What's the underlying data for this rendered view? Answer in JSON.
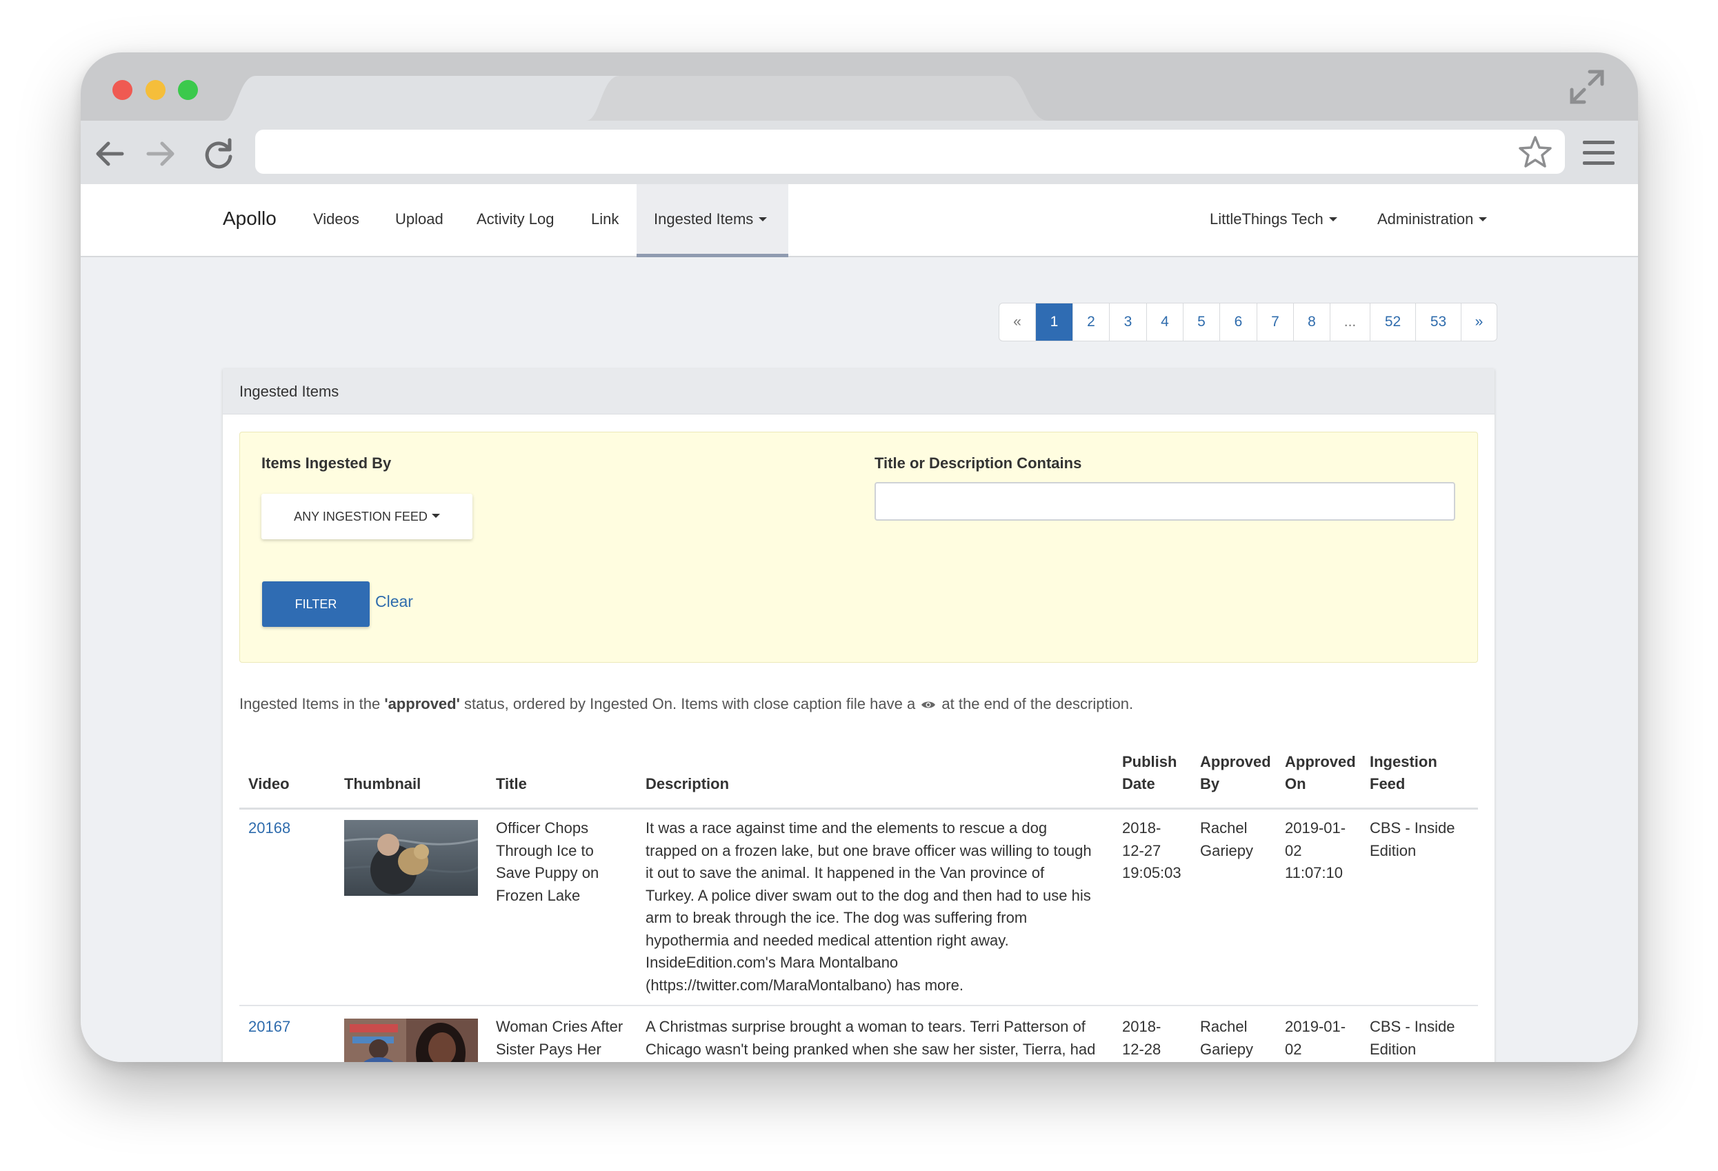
{
  "app": {
    "brand": "Apollo",
    "nav": [
      "Videos",
      "Upload",
      "Activity Log",
      "Link"
    ],
    "active_nav": "Ingested Items",
    "right_nav": [
      "LittleThings Tech",
      "Administration"
    ]
  },
  "pagination": {
    "prev": "«",
    "pages": [
      "1",
      "2",
      "3",
      "4",
      "5",
      "6",
      "7",
      "8",
      "...",
      "52",
      "53"
    ],
    "next": "»",
    "active": "1"
  },
  "panel": {
    "title": "Ingested Items",
    "filter": {
      "ingested_by_label": "Items Ingested By",
      "feed_button": "ANY INGESTION FEED",
      "title_label": "Title or Description Contains",
      "title_value": "",
      "filter_button": "FILTER",
      "clear_link": "Clear"
    },
    "info": {
      "prefix": "Ingested Items in the ",
      "status": "'approved'",
      "middle": " status, ordered by Ingested On. Items with close caption file have a",
      "suffix": " at the end of the description."
    }
  },
  "table": {
    "headers": {
      "video": "Video",
      "thumbnail": "Thumbnail",
      "title": "Title",
      "description": "Description",
      "publish_line1": "Publish",
      "publish_line2": "Date",
      "approved_by_line1": "Approved",
      "approved_by_line2": "By",
      "approved_on_line1": "Approved",
      "approved_on_line2": "On",
      "feed_line1": "Ingestion",
      "feed_line2": "Feed"
    },
    "rows": [
      {
        "video": "20168",
        "title": [
          "Officer Chops",
          "Through Ice to",
          "Save Puppy on",
          "Frozen Lake"
        ],
        "description": [
          "It was a race against time and the elements to rescue a dog",
          "trapped on a frozen lake, but one brave officer was willing to tough",
          "it out to save the animal. It happened in the Van province of",
          "Turkey. A police diver swam out to the dog and then had to use his",
          "arm to break through the ice. The dog was suffering from",
          "hypothermia and needed medical attention right away.",
          "InsideEdition.com's Mara Montalbano",
          "(https://twitter.com/MaraMontalbano) has more."
        ],
        "publish_date": [
          "2018-",
          "12-27",
          "19:05:03"
        ],
        "approved_by": [
          "Rachel",
          "Gariepy"
        ],
        "approved_on": [
          "2019-01-",
          "02",
          "11:07:10"
        ],
        "feed": [
          "CBS - Inside",
          "Edition"
        ]
      },
      {
        "video": "20167",
        "title": [
          "Woman Cries After",
          "Sister Pays Her"
        ],
        "description": [
          "A Christmas surprise brought a woman to tears. Terri Patterson of",
          "Chicago wasn't being pranked when she saw her sister, Tierra, had"
        ],
        "publish_date": [
          "2018-",
          "12-28"
        ],
        "approved_by": [
          "Rachel",
          "Gariepy"
        ],
        "approved_on": [
          "2019-01-",
          "02"
        ],
        "feed": [
          "CBS - Inside",
          "Edition"
        ]
      }
    ]
  }
}
